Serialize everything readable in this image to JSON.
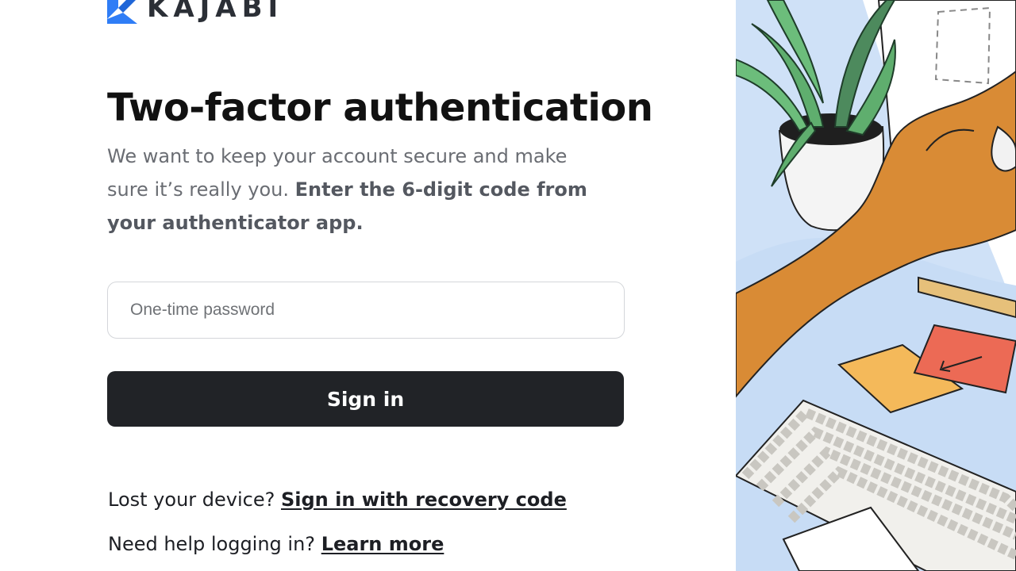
{
  "brand": {
    "name": "KAJABI"
  },
  "page": {
    "title": "Two-factor authentication",
    "description_plain": "We want to keep your account secure and make sure it’s really you.",
    "description_bold": "Enter the 6-digit code from your authenticator app."
  },
  "form": {
    "otp_placeholder": "One-time password",
    "otp_value": "",
    "signin_label": "Sign in"
  },
  "help": {
    "lost_device_text": "Lost your device?",
    "recovery_link": "Sign in with recovery code",
    "need_help_text": "Need help logging in?",
    "learn_more_link": "Learn more"
  },
  "colors": {
    "brand_blue": "#2f7df6",
    "button_bg": "#212327",
    "illustration_bg": "#cfe1f7",
    "hand_skin": "#d98b35",
    "plant_green": "#5fae6e",
    "note_yellow": "#f4b95a",
    "note_red": "#ec6a55"
  },
  "icons": {
    "logo": "kajabi-k-icon",
    "arrow_on_note": "arrow-icon"
  }
}
